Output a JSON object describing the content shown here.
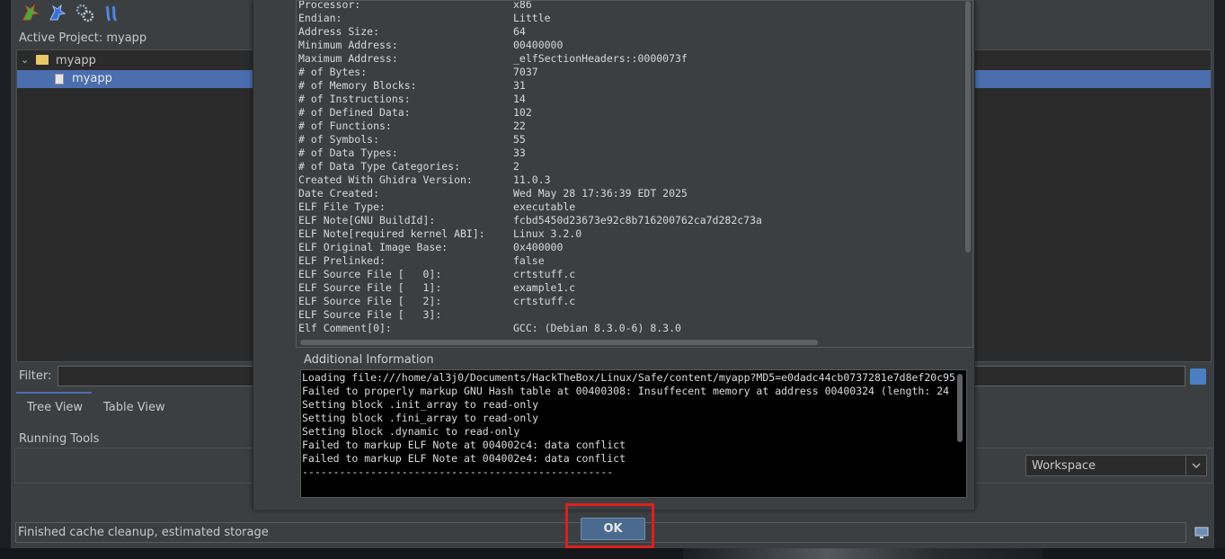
{
  "project": {
    "active_label": "Active Project: myapp",
    "tree": [
      {
        "label": "myapp",
        "type": "folder"
      },
      {
        "label": "myapp",
        "type": "file"
      }
    ],
    "filter_label": "Filter:",
    "filter_value": "",
    "tabs": [
      "Tree View",
      "Table View"
    ],
    "running_tools_label": "Running Tools",
    "workspace_value": "Workspace",
    "status_text": "Finished cache cleanup, estimated storage"
  },
  "dialog": {
    "info": [
      {
        "key": "Processor:",
        "value": "x86"
      },
      {
        "key": "Endian:",
        "value": "Little"
      },
      {
        "key": "Address Size:",
        "value": "64"
      },
      {
        "key": "Minimum Address:",
        "value": "00400000"
      },
      {
        "key": "Maximum Address:",
        "value": "_elfSectionHeaders::0000073f"
      },
      {
        "key": "# of Bytes:",
        "value": "7037"
      },
      {
        "key": "# of Memory Blocks:",
        "value": "31"
      },
      {
        "key": "# of Instructions:",
        "value": "14"
      },
      {
        "key": "# of Defined Data:",
        "value": "102"
      },
      {
        "key": "# of Functions:",
        "value": "22"
      },
      {
        "key": "# of Symbols:",
        "value": "55"
      },
      {
        "key": "# of Data Types:",
        "value": "33"
      },
      {
        "key": "# of Data Type Categories:",
        "value": "2"
      },
      {
        "key": "Created With Ghidra Version:",
        "value": "11.0.3"
      },
      {
        "key": "Date Created:",
        "value": "Wed May 28 17:36:39 EDT 2025"
      },
      {
        "key": "ELF File Type:",
        "value": "executable"
      },
      {
        "key": "ELF Note[GNU BuildId]:",
        "value": "fcbd5450d23673e92c8b716200762ca7d282c73a"
      },
      {
        "key": "ELF Note[required kernel ABI]:",
        "value": "Linux 3.2.0"
      },
      {
        "key": "ELF Original Image Base:",
        "value": "0x400000"
      },
      {
        "key": "ELF Prelinked:",
        "value": "false"
      },
      {
        "key": "ELF Source File [   0]:",
        "value": "crtstuff.c"
      },
      {
        "key": "ELF Source File [   1]:",
        "value": "example1.c"
      },
      {
        "key": "ELF Source File [   2]:",
        "value": "crtstuff.c"
      },
      {
        "key": "ELF Source File [   3]:",
        "value": ""
      },
      {
        "key": "Elf Comment[0]:",
        "value": "GCC: (Debian 8.3.0-6) 8.3.0"
      }
    ],
    "additional_info_label": "Additional Information",
    "log": [
      "Loading file:///home/al3j0/Documents/HackTheBox/Linux/Safe/content/myapp?MD5=e0dadc44cb0737281e7d8ef20c95",
      "Failed to properly markup GNU Hash table at 00400308: Insuffecent memory at address 00400324 (length: 24",
      "Setting block .init_array to read-only",
      "Setting block .fini_array to read-only",
      "Setting block .dynamic to read-only",
      "Failed to markup ELF Note at 004002c4: data conflict",
      "Failed to markup ELF Note at 004002e4: data conflict",
      "--------------------------------------------------"
    ],
    "ok_label": "OK"
  },
  "icons": [
    "dragon-icon",
    "dragon-blue-icon",
    "gears-icon",
    "debugger-icon",
    "chevron-down-icon",
    "folder-icon",
    "file-icon",
    "refresh-icon",
    "monitor-icon"
  ],
  "colors": {
    "selection": "#4b6eaf",
    "highlight": "#e01e1e",
    "ok_button": "#4a6a8f"
  }
}
